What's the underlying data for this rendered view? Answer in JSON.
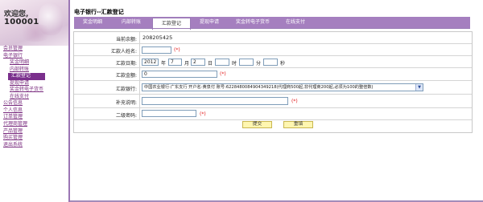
{
  "sidebar": {
    "welcome": "欢迎您,",
    "user_id": "100001",
    "items": [
      {
        "label": "会员管理",
        "sub": false,
        "active": false
      },
      {
        "label": "电子银行",
        "sub": false,
        "active": false
      },
      {
        "label": "奖金明细",
        "sub": true,
        "active": false
      },
      {
        "label": "内部转账",
        "sub": true,
        "active": false
      },
      {
        "label": "汇款登记",
        "sub": true,
        "active": true
      },
      {
        "label": "提现申请",
        "sub": true,
        "active": false
      },
      {
        "label": "奖金转电子货币",
        "sub": true,
        "active": false
      },
      {
        "label": "在线支付",
        "sub": true,
        "active": false
      },
      {
        "label": "公告信息",
        "sub": false,
        "active": false
      },
      {
        "label": "个人信息",
        "sub": false,
        "active": false
      },
      {
        "label": "订单管理",
        "sub": false,
        "active": false
      },
      {
        "label": "代理商管理",
        "sub": false,
        "active": false
      },
      {
        "label": "产品管理",
        "sub": false,
        "active": false
      },
      {
        "label": "购买管理",
        "sub": false,
        "active": false
      },
      {
        "label": "退出系统",
        "sub": false,
        "active": false
      }
    ]
  },
  "page": {
    "title": "电子银行--汇款登记"
  },
  "tabs": [
    {
      "label": "奖金明细",
      "active": false
    },
    {
      "label": "内部转账",
      "active": false
    },
    {
      "label": "汇款登记",
      "active": true
    },
    {
      "label": "提现申请",
      "active": false
    },
    {
      "label": "奖金转电子货币",
      "active": false
    },
    {
      "label": "在线支付",
      "active": false
    }
  ],
  "form": {
    "balance_label": "当前余额:",
    "balance_value": "208205425",
    "remitter_label": "汇款人姓名:",
    "remitter_value": "",
    "required_mark": "(*)",
    "date_label": "汇款日期:",
    "year": "2012",
    "year_unit": "年",
    "month": "7",
    "month_unit": "月",
    "day": "2",
    "day_unit": "日",
    "hour": "",
    "hour_unit": "时",
    "minute": "",
    "minute_unit": "分",
    "second": "",
    "second_unit": "秒",
    "amount_label": "汇款金额:",
    "amount_value": "0",
    "bank_label": "汇款银行:",
    "bank_selected": "中国农业银行·广东支行  开户名:黄泉付 账号:6228480084904349218(代理商500起,非代理商200起,必须为100的整倍数)",
    "note_label": "补充说明:",
    "note_value": "",
    "password_label": "二级密码:",
    "password_value": "",
    "submit_label": "提交",
    "reset_label": "重填"
  },
  "colors": {
    "accent": "#7a2f8c",
    "tab_bar": "#a57fbf",
    "required": "#e21b1b",
    "button_bg": "#fff6b0"
  }
}
